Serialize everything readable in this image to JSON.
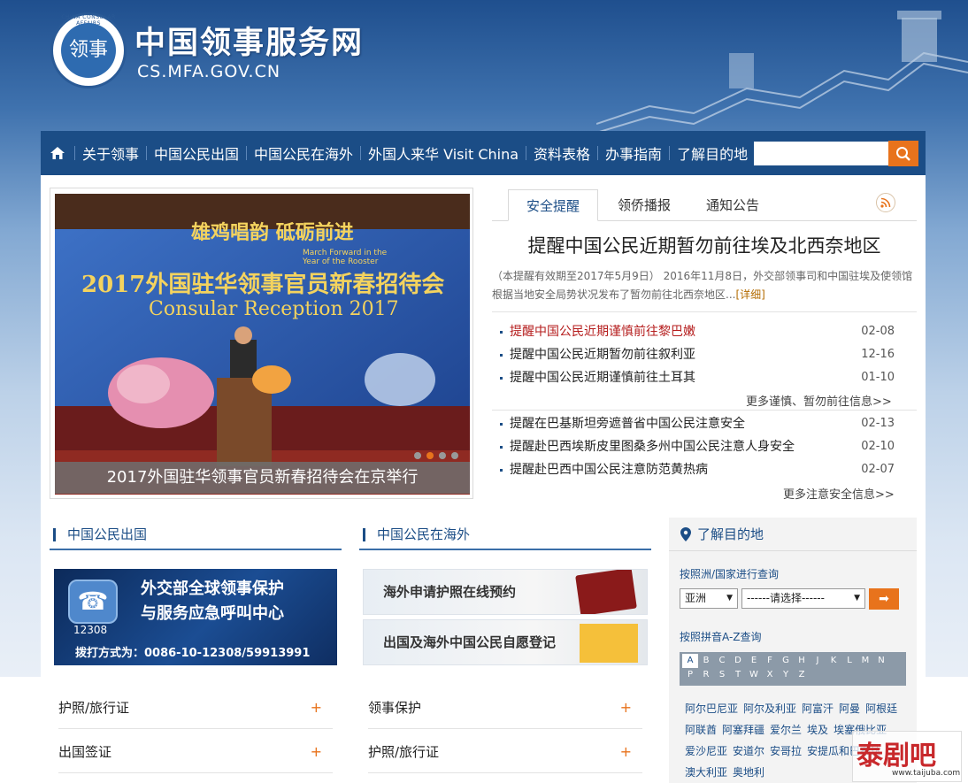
{
  "header": {
    "seal_text": "领事",
    "seal_ring": "CHINA CONSULAR AFFAIRS",
    "title": "中国领事服务网",
    "url": "CS.MFA.GOV.CN"
  },
  "nav": {
    "items": [
      "关于领事",
      "中国公民出国",
      "中国公民在海外",
      "外国人来华 Visit China",
      "资料表格",
      "办事指南",
      "了解目的地"
    ],
    "search_value": ""
  },
  "slideshow": {
    "caption": "2017外国驻华领事官员新春招待会在京举行",
    "banner_line1": "雄鸡唱韵 砥砺前进",
    "banner_line2": "2017外国驻华领事官员新春招待会",
    "banner_line3": "Consular Reception 2017",
    "banner_en": "March Forward in the Year of the Rooster"
  },
  "tabs": [
    "安全提醒",
    "领侨播报",
    "通知公告"
  ],
  "headline": "提醒中国公民近期暂勿前往埃及北西奈地区",
  "summary": {
    "text": "（本提醒有效期至2017年5月9日） 2016年11月8日，外交部领事司和中国驻埃及使领馆根据当地安全局势状况发布了暂勿前往北西奈地区...",
    "link": "[详细]"
  },
  "list1": [
    {
      "title": "提醒中国公民近期谨慎前往黎巴嫩",
      "date": "02-08",
      "red": true
    },
    {
      "title": "提醒中国公民近期暂勿前往叙利亚",
      "date": "12-16",
      "red": false
    },
    {
      "title": "提醒中国公民近期谨慎前往土耳其",
      "date": "01-10",
      "red": false
    }
  ],
  "more1": "更多谨慎、暂勿前往信息>>",
  "list2": [
    {
      "title": "提醒在巴基斯坦旁遮普省中国公民注意安全",
      "date": "02-13"
    },
    {
      "title": "提醒赴巴西埃斯皮里图桑多州中国公民注意人身安全",
      "date": "02-10"
    },
    {
      "title": "提醒赴巴西中国公民注意防范黄热病",
      "date": "02-07"
    }
  ],
  "more2": "更多注意安全信息>>",
  "section_left": {
    "title": "中国公民出国",
    "banner": {
      "line1": "外交部全球领事保护",
      "line2": "与服务应急呼叫中心",
      "number": "12308",
      "dial": "拨打方式为：0086-10-12308/59913991"
    },
    "links": [
      "护照/旅行证",
      "出国签证"
    ]
  },
  "section_mid": {
    "title": "中国公民在海外",
    "banner1": "海外申请护照在线预约",
    "banner2": "出国及海外中国公民自愿登记",
    "links": [
      "领事保护",
      "护照/旅行证"
    ]
  },
  "destination": {
    "title": "了解目的地",
    "by_country": "按照洲/国家进行查询",
    "continent": "亚洲",
    "country": "------请选择------",
    "go": "➡",
    "by_pinyin": "按照拼音A-Z查询",
    "letters_row1": [
      "A",
      "B",
      "C",
      "D",
      "E",
      "F",
      "G",
      "H",
      "J",
      "K",
      "L",
      "M",
      "N"
    ],
    "letters_row2": [
      "P",
      "R",
      "S",
      "T",
      "W",
      "X",
      "Y",
      "Z"
    ],
    "countries": [
      "阿尔巴尼亚",
      "阿尔及利亚",
      "阿富汗",
      "阿曼",
      "阿根廷",
      "阿联酋",
      "阿塞拜疆",
      "爱尔兰",
      "埃及",
      "埃塞俄比亚",
      "爱沙尼亚",
      "安道尔",
      "安哥拉",
      "安提瓜和巴布达",
      "澳大利亚",
      "奥地利"
    ]
  },
  "watermark": {
    "brand": "泰剧吧",
    "site": "www.taijuba.com"
  },
  "colors": {
    "nav_bg": "#1b4d86",
    "accent": "#e8731c",
    "alert_red": "#b51d1d"
  }
}
